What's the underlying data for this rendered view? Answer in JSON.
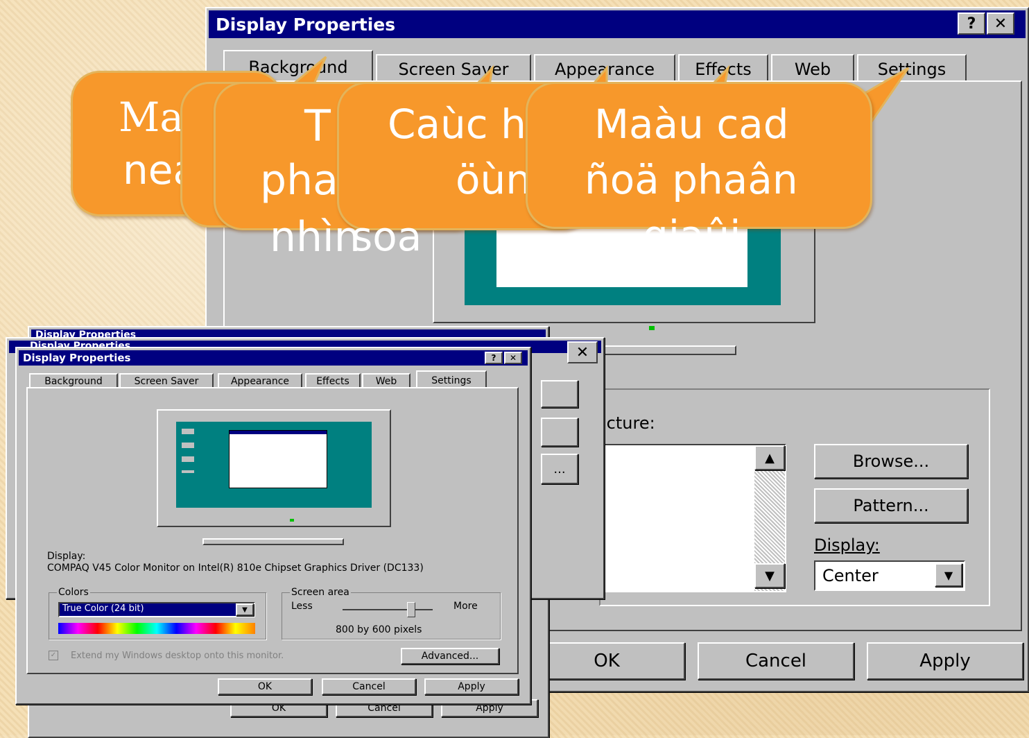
{
  "big_window": {
    "title": "Display Properties",
    "help_button": "?",
    "close_button": "✕",
    "tabs": [
      "Background",
      "Screen Saver",
      "Appearance",
      "Effects",
      "Web",
      "Settings"
    ],
    "wallpaper_label": "icture:",
    "browse_button": "Browse...",
    "pattern_button": "Pattern...",
    "display_label": "Display:",
    "display_value": "Center",
    "ok_button": "OK",
    "cancel_button": "Cancel",
    "apply_button": "Apply"
  },
  "back_windows": {
    "title_a": "Display Properties",
    "title_b": "Display Properties",
    "button_ellipsis": "...",
    "ok": "OK",
    "cancel": "Cancel",
    "apply": "Apply"
  },
  "settings_window": {
    "title": "Display Properties",
    "help_button": "?",
    "close_button": "✕",
    "tabs": [
      "Background",
      "Screen Saver",
      "Appearance",
      "Effects",
      "Web",
      "Settings"
    ],
    "display_label": "Display:",
    "display_value": "COMPAQ V45 Color Monitor on Intel(R) 810e Chipset Graphics Driver (DC133)",
    "colors_group": "Colors",
    "colors_value": "True Color (24 bit)",
    "screen_area_group": "Screen area",
    "less_label": "Less",
    "more_label": "More",
    "resolution": "800 by 600 pixels",
    "resolution_slider_level": 0.75,
    "extend_checkbox": "Extend my Windows desktop onto this monitor.",
    "advanced_button": "Advanced...",
    "ok_button": "OK",
    "cancel_button": "Cancel",
    "apply_button": "Apply"
  },
  "callouts": [
    {
      "line1": "Ma",
      "line2": "nea"
    },
    {
      "line1": "",
      "line2": ""
    },
    {
      "line1": "T",
      "line2": "pha",
      "line3": "nhìn"
    },
    {
      "line1": "Caùc h",
      "line2": "öùn",
      "line3": "soa"
    },
    {
      "line1": "Maàu cad",
      "line2": "ñoä phaân",
      "line3": "giaûi"
    }
  ],
  "colors": {
    "title_bar": "#000080",
    "window_face": "#c0c0c0",
    "desktop_teal": "#008080",
    "callout_fill": "#f7982b",
    "callout_border": "#e3b45b"
  }
}
